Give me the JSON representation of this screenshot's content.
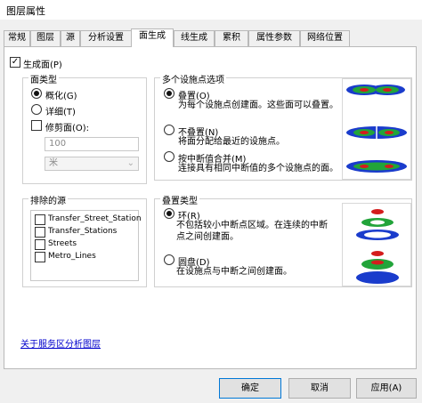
{
  "window": {
    "title": "图层属性"
  },
  "tabs": [
    "常规",
    "图层",
    "源",
    "分析设置",
    "面生成",
    "线生成",
    "累积",
    "属性参数",
    "网络位置"
  ],
  "generate_polygons": {
    "label": "生成面(P)",
    "checked": true
  },
  "polygon_type": {
    "title": "面类型",
    "generalized": "概化(G)",
    "detailed": "详细(T)",
    "trim": "修剪面(O):",
    "trim_value": "100",
    "trim_unit": "米"
  },
  "multiple_facilities": {
    "title": "多个设施点选项",
    "options": [
      {
        "label": "叠置(O)",
        "desc": "为每个设施点创建面。这些面可以叠置。",
        "selected": true
      },
      {
        "label": "不叠置(N)",
        "desc": "将面分配给最近的设施点。",
        "selected": false
      },
      {
        "label": "按中断值合并(M)",
        "desc": "连接具有相同中断值的多个设施点的面。",
        "selected": false
      }
    ]
  },
  "exclusion_sources": {
    "title": "排除的源",
    "items": [
      "Transfer_Street_Station",
      "Transfer_Stations",
      "Streets",
      "Metro_Lines"
    ]
  },
  "overlap_type": {
    "title": "叠置类型",
    "ring": {
      "label": "环(R)",
      "desc": "不包括较小中断点区域。在连续的中断点之间创建面。"
    },
    "disk": {
      "label": "圆盘(D)",
      "desc": "在设施点与中断之间创建面。"
    }
  },
  "link": "关于服务区分析图层",
  "buttons": {
    "ok": "确定",
    "cancel": "取消",
    "apply": "应用(A)"
  },
  "colors": {
    "blue": "#1a3ccc",
    "green": "#22a43a",
    "red": "#d41c1c",
    "link": "#0000cc"
  }
}
